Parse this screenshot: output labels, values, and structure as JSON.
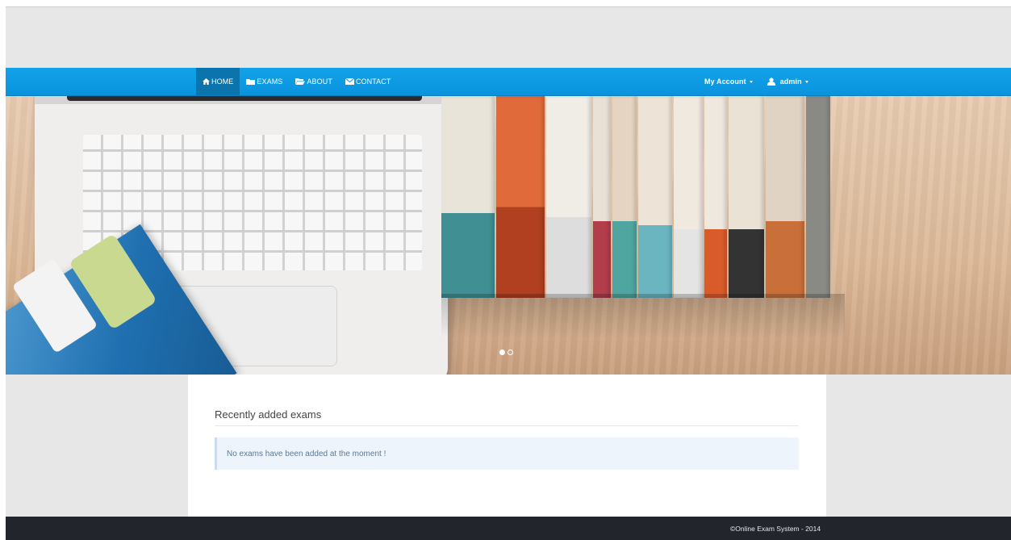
{
  "navbar": {
    "left": [
      {
        "label": "HOME",
        "icon": "home-icon",
        "active": true
      },
      {
        "label": "EXAMS",
        "icon": "folder-icon",
        "active": false
      },
      {
        "label": "ABOUT",
        "icon": "folder-open-icon",
        "active": false
      },
      {
        "label": "CONTACT",
        "icon": "envelope-icon",
        "active": false
      }
    ],
    "account_label": "My Account",
    "user_label": "admin"
  },
  "carousel": {
    "image_icon": "laptop-books-photo",
    "indicators": 2,
    "active_index": 0
  },
  "main": {
    "section_title": "Recently added exams",
    "empty_message": "No exams have been added at the moment !"
  },
  "footer": {
    "copyright": "©Online Exam System - 2014"
  },
  "colors": {
    "navbar": "#0a93dd",
    "navbar_active": "#0c74ad",
    "page_bg": "#e7e7e7",
    "footer_bg": "#22252c",
    "alert_bg": "#eef4fb"
  }
}
